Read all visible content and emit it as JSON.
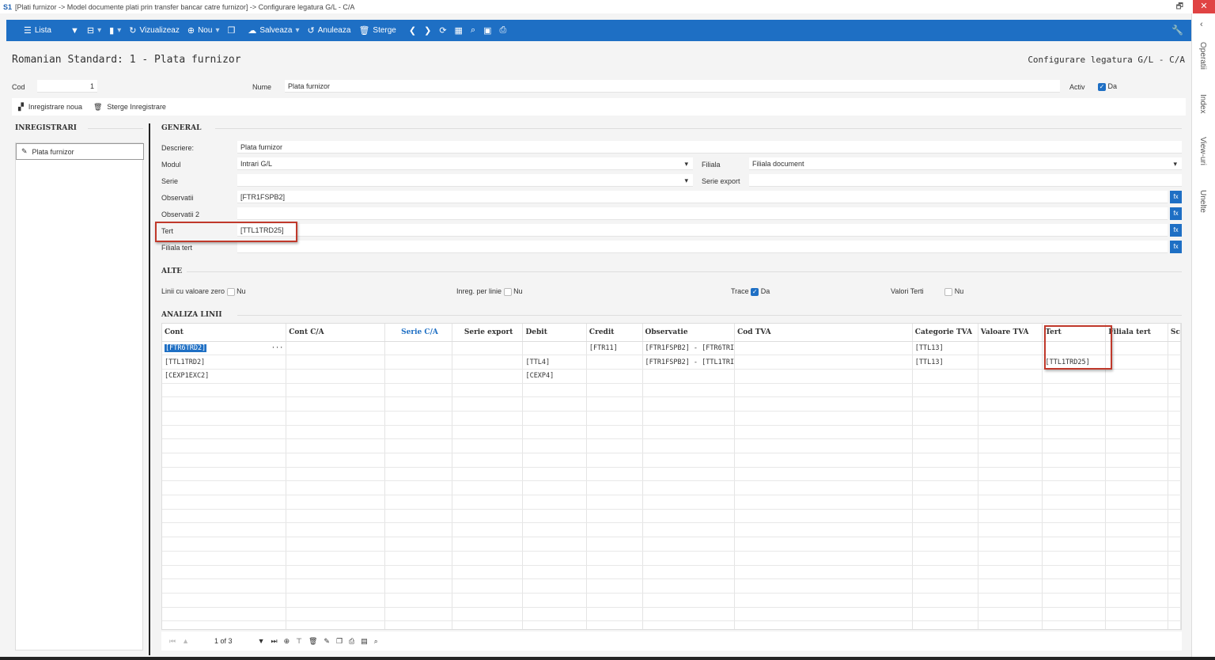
{
  "window": {
    "logo": "S1",
    "title": "[Plati furnizor -> Model documente plati prin transfer bancar catre furnizor] -> Configurare legatura G/L - C/A",
    "restore": "🗗",
    "close": "✕"
  },
  "toolbar": {
    "lista": "Lista",
    "vizualizeaza": "Vizualizeaz",
    "nou": "Nou",
    "salveaza": "Salveaza",
    "anuleaza": "Anuleaza",
    "sterge": "Sterge"
  },
  "rail": {
    "operatii": "Operatii",
    "index": "Index",
    "viewuri": "View-uri",
    "unelte": "Unelte"
  },
  "page": {
    "title": "Romanian Standard: 1 - Plata furnizor",
    "subtitle": "Configurare legatura G/L - C/A"
  },
  "header": {
    "cod_label": "Cod",
    "cod_value": "1",
    "nume_label": "Nume",
    "nume_value": "Plata furnizor",
    "activ_label": "Activ",
    "activ_value": "Da"
  },
  "actions": {
    "new": "Inregistrare noua",
    "delete": "Sterge Inregistrare"
  },
  "left": {
    "header": "INREGISTRARI",
    "items": [
      {
        "label": "Plata furnizor"
      }
    ]
  },
  "general": {
    "header": "GENERAL",
    "descriere_label": "Descriere:",
    "descriere_value": "Plata furnizor",
    "modul_label": "Modul",
    "modul_value": "Intrari G/L",
    "filiala_label": "Filiala",
    "filiala_value": "Filiala document",
    "serie_label": "Serie",
    "serie_value": "",
    "serie_export_label": "Serie export",
    "serie_export_value": "",
    "observatii_label": "Observatii",
    "observatii_value": "[FTR1FSPB2]",
    "observatii2_label": "Observatii 2",
    "observatii2_value": "",
    "tert_label": "Tert",
    "tert_value": "[TTL1TRD25]",
    "filiala_tert_label": "Filiala tert",
    "filiala_tert_value": "",
    "fx": "fx"
  },
  "alte": {
    "header": "ALTE",
    "linii_label": "Linii cu valoare zero",
    "linii_value": "Nu",
    "inreg_label": "Inreg. per linie",
    "inreg_value": "Nu",
    "trace_label": "Trace",
    "trace_value": "Da",
    "valori_label": "Valori Terti",
    "valori_value": "Nu"
  },
  "analiza": {
    "header": "ANALIZA LINII",
    "columns": [
      "Cont",
      "Cont C/A",
      "Serie C/A",
      "Serie export",
      "Debit",
      "Credit",
      "Observatie",
      "Cod TVA",
      "Categorie TVA",
      "Valoare TVA",
      "Tert",
      "Filiala tert",
      "Sc"
    ],
    "rows": [
      [
        "[FTR6TRD2]",
        "",
        "",
        "",
        "",
        "[FTR11]",
        "[FTR1FSPB2] - [FTR6TRI",
        "",
        "[TTL13]",
        "",
        "",
        "",
        ""
      ],
      [
        "[TTL1TRD2]",
        "",
        "",
        "",
        "[TTL4]",
        "",
        "[FTR1FSPB2] - [TTL1TRI",
        "",
        "[TTL13]",
        "",
        "[TTL1TRD25]",
        "",
        ""
      ],
      [
        "[CEXP1EXC2]",
        "",
        "",
        "",
        "[CEXP4]",
        "",
        "",
        "",
        "",
        "",
        "",
        "",
        ""
      ]
    ],
    "ellipsis": "···"
  },
  "pager": {
    "first": "⏮",
    "prev": "▲",
    "page": "1 of 3"
  }
}
